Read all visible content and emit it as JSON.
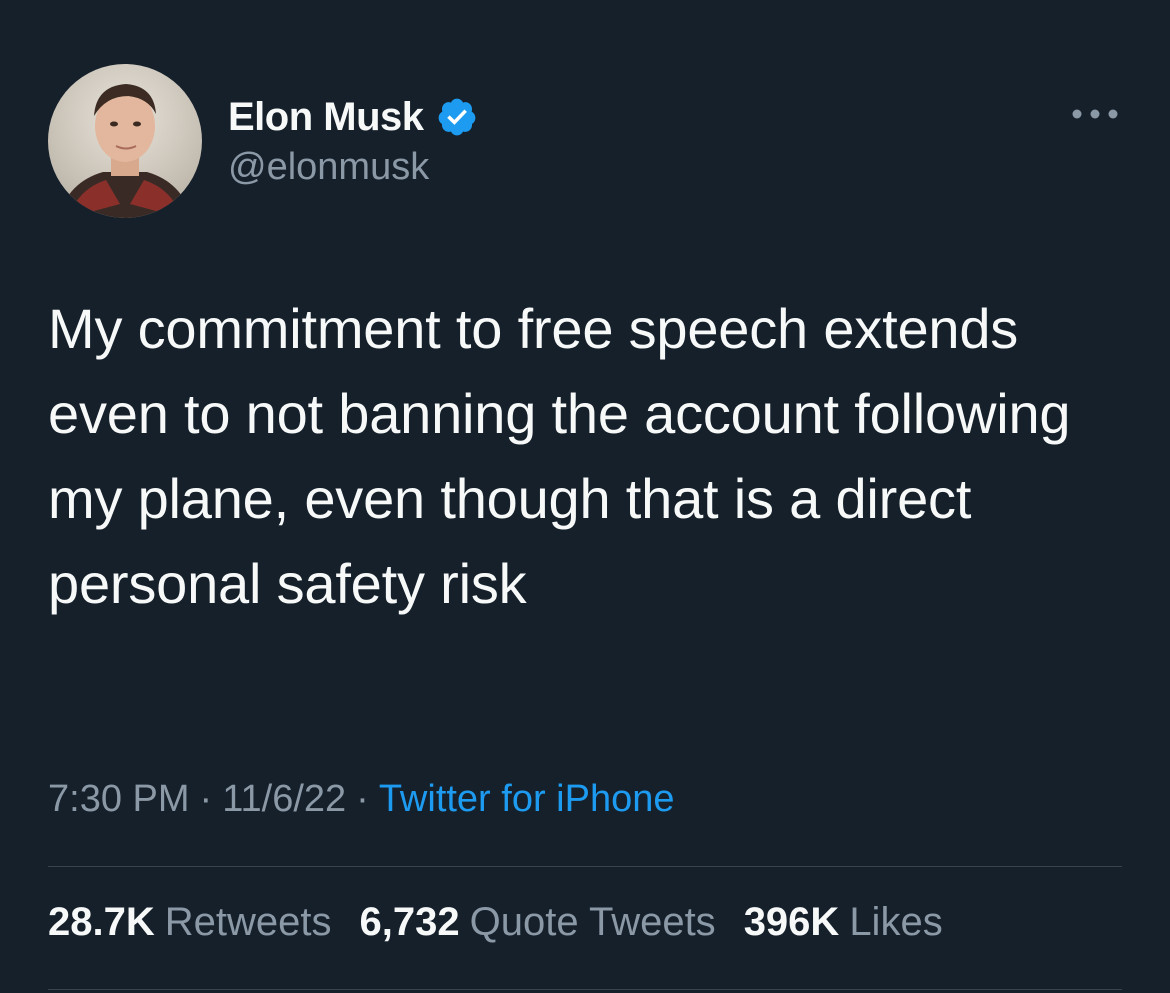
{
  "author": {
    "display_name": "Elon Musk",
    "handle": "@elonmusk",
    "verified": true,
    "avatar_icon": "profile-photo"
  },
  "more_icon": "ellipsis-icon",
  "tweet": {
    "text": "My commitment to free speech extends even to not banning the account following my plane, even though that is a direct personal safety risk",
    "time": "7:30 PM",
    "date": "11/6/22",
    "separator": "·",
    "source": "Twitter for iPhone"
  },
  "stats": {
    "retweets": {
      "value": "28.7K",
      "label": "Retweets"
    },
    "quote_tweets": {
      "value": "6,732",
      "label": "Quote Tweets"
    },
    "likes": {
      "value": "396K",
      "label": "Likes"
    }
  },
  "colors": {
    "background": "#15202b",
    "primary_text": "#f7f9f9",
    "secondary_text": "#8b98a5",
    "accent": "#1d9bf0",
    "divider": "#38444d"
  }
}
